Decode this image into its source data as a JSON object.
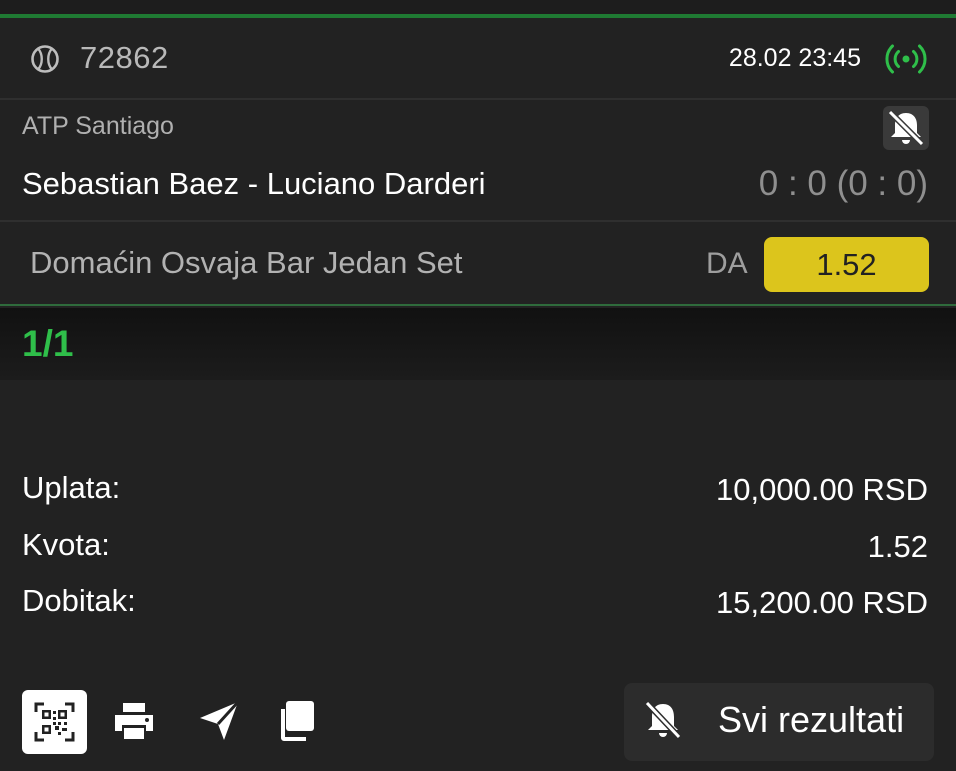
{
  "colors": {
    "background": "#222222",
    "accent_green": "#1f7a33",
    "live_green": "#2fbf4a",
    "odd_yellow": "#dcc51c"
  },
  "ticket": {
    "sport_icon": "tennis-ball-icon",
    "id": "72862",
    "datetime": "28.02 23:45",
    "live_icon": "live-broadcast-icon"
  },
  "event": {
    "league": "ATP Santiago",
    "match": "Sebastian Baez - Luciano Darderi",
    "score": "0 : 0 (0 : 0)",
    "mute_icon": "bell-off-icon"
  },
  "selection": {
    "market": "Domaćin Osvaja Bar Jedan Set",
    "pick": "DA",
    "odd": "1.52"
  },
  "counter": "1/1",
  "summary": {
    "stake_label": "Uplata:",
    "stake_value": "10,000.00 RSD",
    "odds_label": "Kvota:",
    "odds_value": "1.52",
    "payout_label": "Dobitak:",
    "payout_value": "15,200.00 RSD"
  },
  "actions": {
    "icons": [
      "qr-code-icon",
      "print-icon",
      "send-icon",
      "copy-icon"
    ],
    "results_icon": "bell-off-icon",
    "results_label": "Svi rezultati"
  }
}
